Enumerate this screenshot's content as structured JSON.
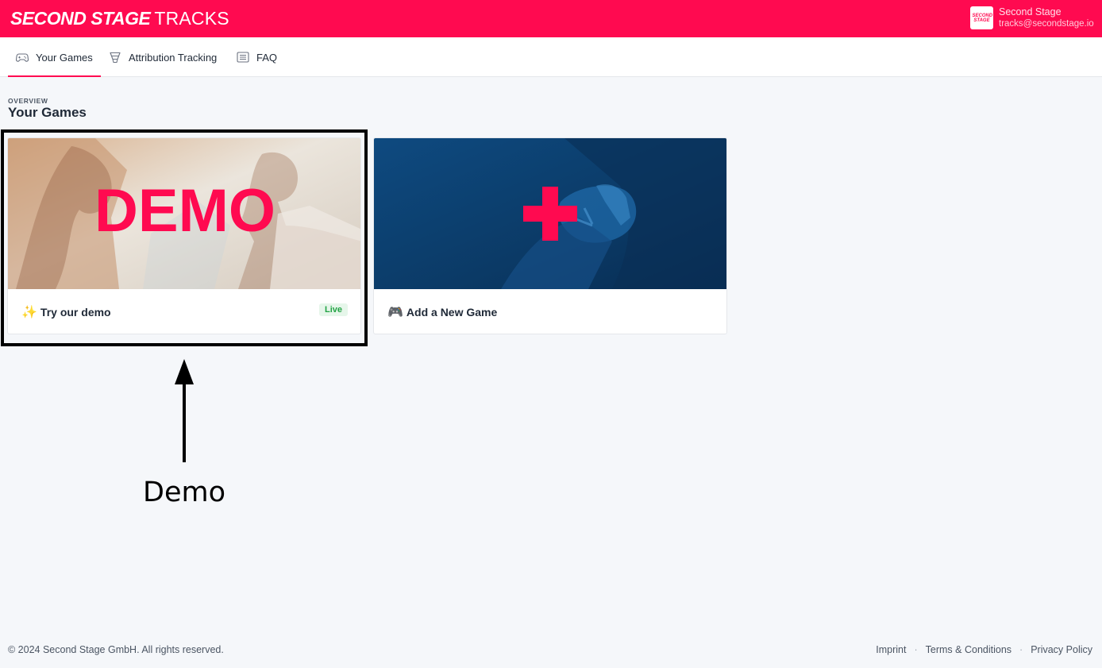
{
  "header": {
    "brand_strong": "SECOND STAGE",
    "brand_light": "TRACKS",
    "account_logo_text": "SECOND STAGE",
    "account_name": "Second Stage",
    "account_email": "tracks@secondstage.io",
    "accent_color": "#ff0a50"
  },
  "nav": {
    "tabs": [
      {
        "label": "Your Games",
        "icon": "gamepad-icon",
        "active": true
      },
      {
        "label": "Attribution Tracking",
        "icon": "funnel-icon",
        "active": false
      },
      {
        "label": "FAQ",
        "icon": "list-icon",
        "active": false
      }
    ]
  },
  "page": {
    "eyebrow": "OVERVIEW",
    "title": "Your Games"
  },
  "cards": [
    {
      "image_text": "DEMO",
      "emoji": "✨",
      "title": "Try our demo",
      "badge": "Live"
    },
    {
      "image_text": "+",
      "emoji": "🎮",
      "title": "Add a New Game"
    }
  ],
  "annotation": {
    "label": "Demo"
  },
  "footer": {
    "copyright": "© 2024 Second Stage GmbH. All rights reserved.",
    "links": [
      "Imprint",
      "Terms & Conditions",
      "Privacy Policy"
    ],
    "separator": "·"
  }
}
